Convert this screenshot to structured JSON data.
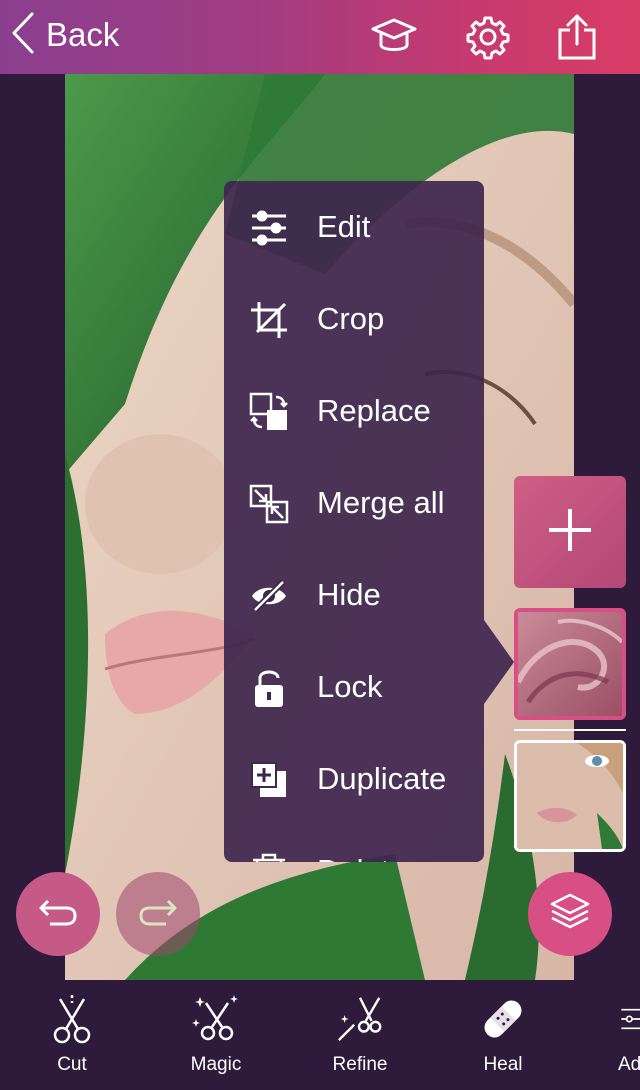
{
  "header": {
    "back_label": "Back",
    "icons": [
      "graduation-cap-icon",
      "gear-icon",
      "share-icon"
    ]
  },
  "context_menu": {
    "items": [
      {
        "label": "Edit",
        "icon": "sliders-icon"
      },
      {
        "label": "Crop",
        "icon": "crop-icon"
      },
      {
        "label": "Replace",
        "icon": "replace-icon"
      },
      {
        "label": "Merge all",
        "icon": "merge-icon"
      },
      {
        "label": "Hide",
        "icon": "eye-slash-icon"
      },
      {
        "label": "Lock",
        "icon": "lock-icon"
      },
      {
        "label": "Duplicate",
        "icon": "duplicate-icon"
      },
      {
        "label": "Delete",
        "icon": "trash-icon"
      }
    ]
  },
  "layers": {
    "add_icon": "plus-icon",
    "items": [
      {
        "name": "wave",
        "selected": true
      },
      {
        "name": "portrait",
        "selected": false
      }
    ]
  },
  "actions": {
    "undo_icon": "undo-icon",
    "redo_icon": "redo-icon",
    "layers_icon": "layers-icon"
  },
  "toolbar": {
    "tools": [
      {
        "label": "Cut",
        "icon": "scissors-icon"
      },
      {
        "label": "Magic",
        "icon": "magic-scissors-icon"
      },
      {
        "label": "Refine",
        "icon": "wand-scissors-icon"
      },
      {
        "label": "Heal",
        "icon": "bandage-icon"
      },
      {
        "label": "Ad",
        "icon": "sliders-icon"
      }
    ]
  },
  "colors": {
    "accent": "#d84f86",
    "background": "#2e1b3c",
    "menu": "#3e264e"
  }
}
